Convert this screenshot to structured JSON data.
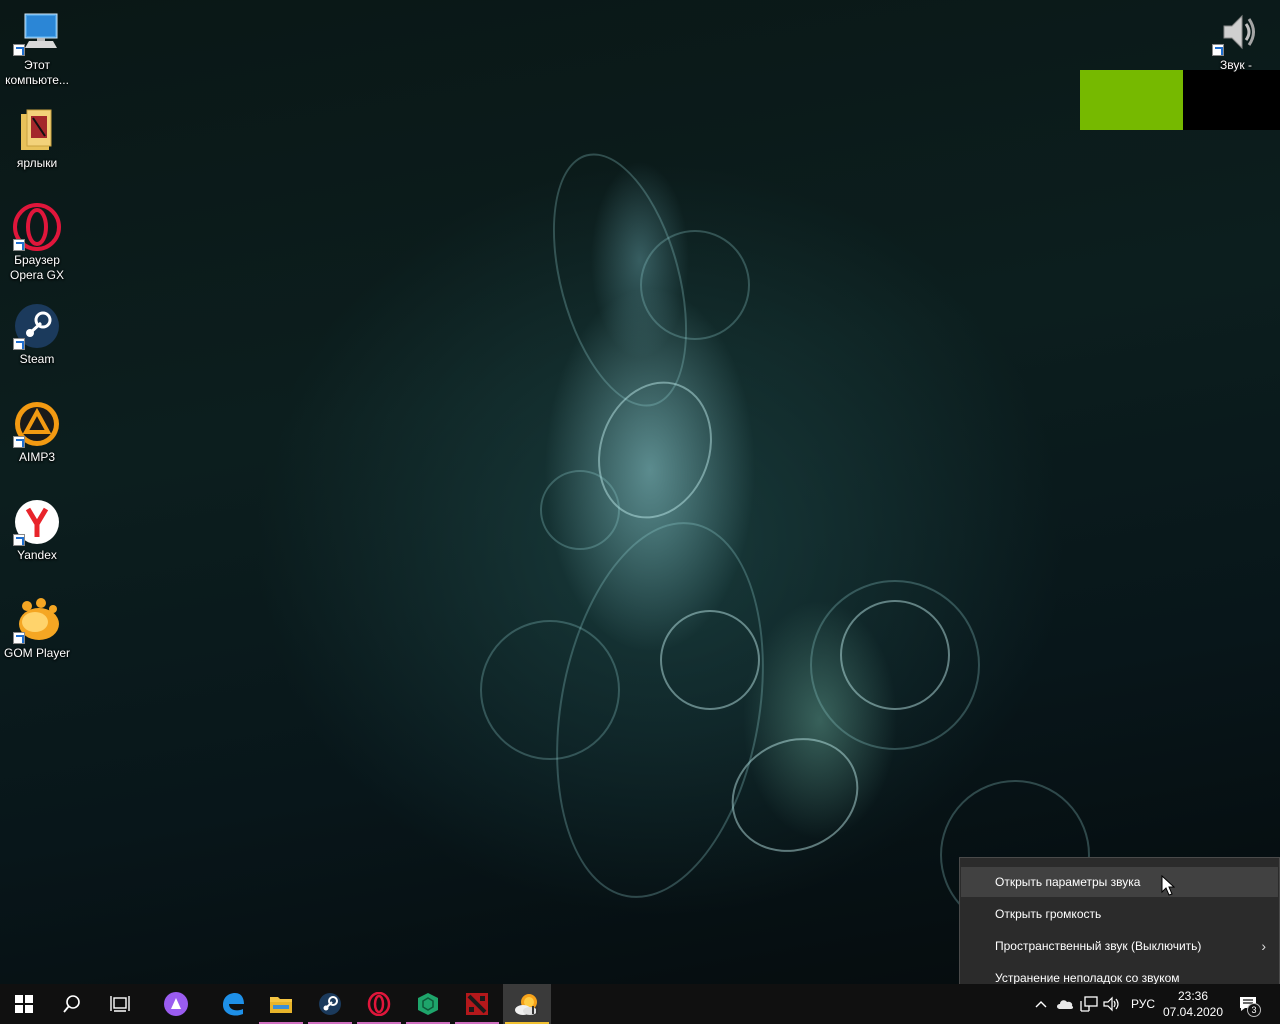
{
  "desktop": {
    "icons": [
      {
        "label": "Этот\nкомпьюте...",
        "icon": "this-pc-icon"
      },
      {
        "label": "ярлыки",
        "icon": "folder-icon"
      },
      {
        "label": "Браузер\nOpera GX",
        "icon": "opera-gx-icon"
      },
      {
        "label": "Steam",
        "icon": "steam-icon"
      },
      {
        "label": "AIMP3",
        "icon": "aimp-icon"
      },
      {
        "label": "Yandex",
        "icon": "yandex-icon"
      },
      {
        "label": "GOM Player",
        "icon": "gom-player-icon"
      },
      {
        "label": "Звук -",
        "icon": "speaker-icon"
      }
    ],
    "overlay_colors": {
      "green": "#76b900",
      "black": "#000000"
    }
  },
  "context_menu": {
    "items": [
      {
        "label": "Открыть параметры звука",
        "hovered": true
      },
      {
        "label": "Открыть громкость"
      },
      {
        "label": "Пространственный звук (Выключить)",
        "submenu": true
      },
      {
        "label": "Устранение неполадок со звуком"
      }
    ]
  },
  "taskbar": {
    "pinned": [
      {
        "name": "start",
        "icon": "windows-logo-icon"
      },
      {
        "name": "search",
        "icon": "search-icon"
      },
      {
        "name": "task-view",
        "icon": "task-view-icon"
      },
      {
        "name": "alice",
        "icon": "alice-icon"
      },
      {
        "name": "edge",
        "icon": "edge-icon"
      },
      {
        "name": "file-explorer",
        "icon": "folder-icon",
        "running": true
      },
      {
        "name": "steam",
        "icon": "steam-icon",
        "running": true
      },
      {
        "name": "opera-gx",
        "icon": "opera-gx-icon",
        "running": true
      },
      {
        "name": "razer-cortex",
        "icon": "hexagon-icon",
        "running": true
      },
      {
        "name": "dota-2",
        "icon": "dota-icon",
        "running": true
      },
      {
        "name": "weather-app",
        "icon": "sun-cloud-icon",
        "running": true,
        "active": true
      }
    ],
    "tray": {
      "icons": [
        "chevron-up-icon",
        "onedrive-icon",
        "network-icon",
        "volume-icon"
      ],
      "language": "РУС",
      "time": "23:36",
      "date": "07.04.2020",
      "notifications_count": "3"
    },
    "colors": {
      "running_underline": "#d070c0",
      "active_underline": "#f0c030"
    }
  }
}
